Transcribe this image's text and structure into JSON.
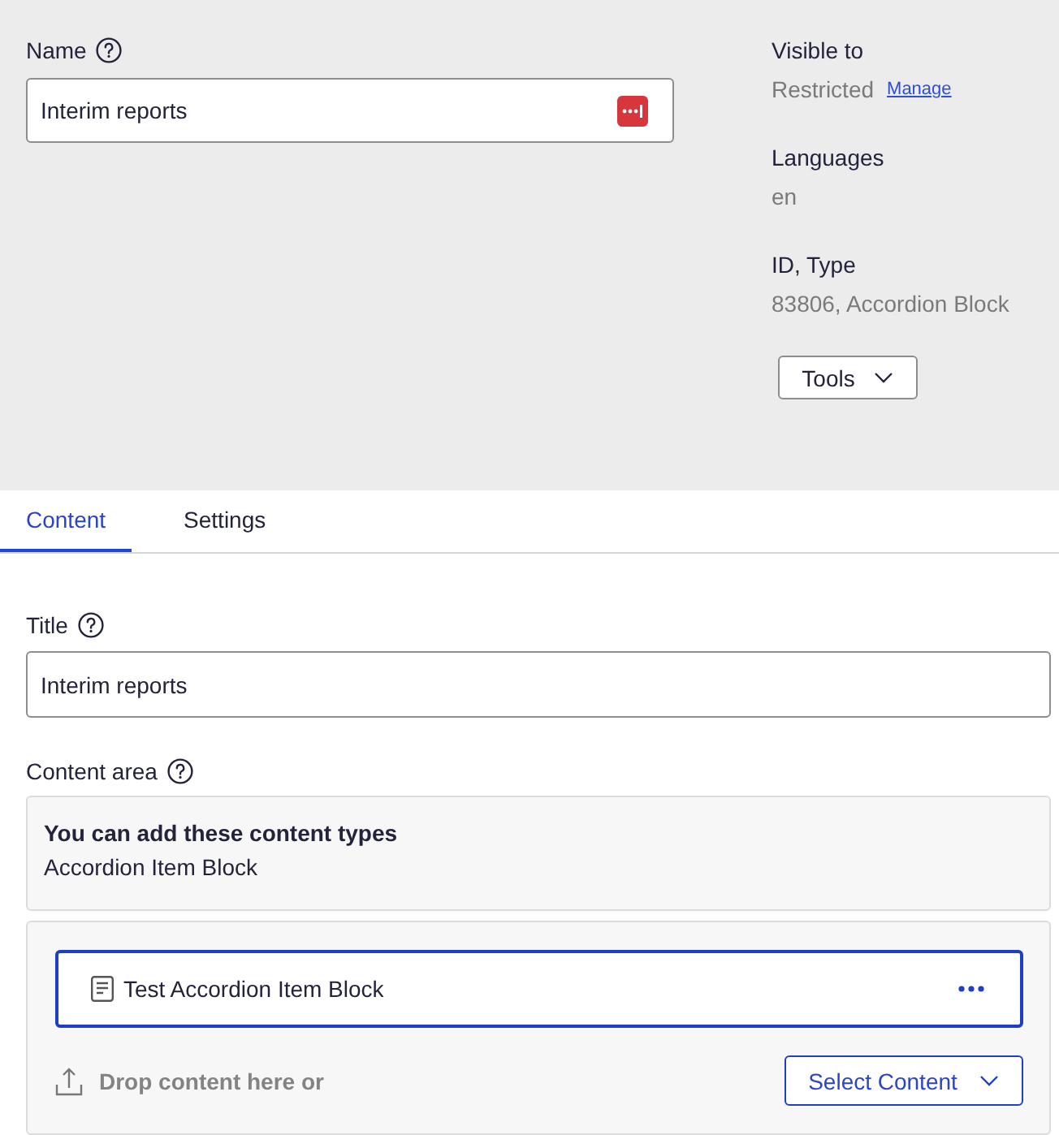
{
  "name_field": {
    "label": "Name",
    "value": "Interim reports"
  },
  "meta": [
    {
      "label": "Visible to",
      "value": "Restricted",
      "link": "Manage"
    },
    {
      "label": "Languages",
      "value": "en"
    },
    {
      "label": "ID, Type",
      "value": "83806, Accordion Block"
    }
  ],
  "tools_button": {
    "label": "Tools"
  },
  "tabs": [
    {
      "label": "Content",
      "selected": true
    },
    {
      "label": "Settings",
      "selected": false
    }
  ],
  "title_field": {
    "label": "Title",
    "value": "Interim reports"
  },
  "content_area": {
    "label": "Content area",
    "info_heading": "You can add these content types",
    "info_types": "Accordion Item Block",
    "items": [
      {
        "label": "Test Accordion Item Block",
        "selected": true
      }
    ],
    "drop_hint": "Drop content here or",
    "select_button": "Select Content"
  }
}
